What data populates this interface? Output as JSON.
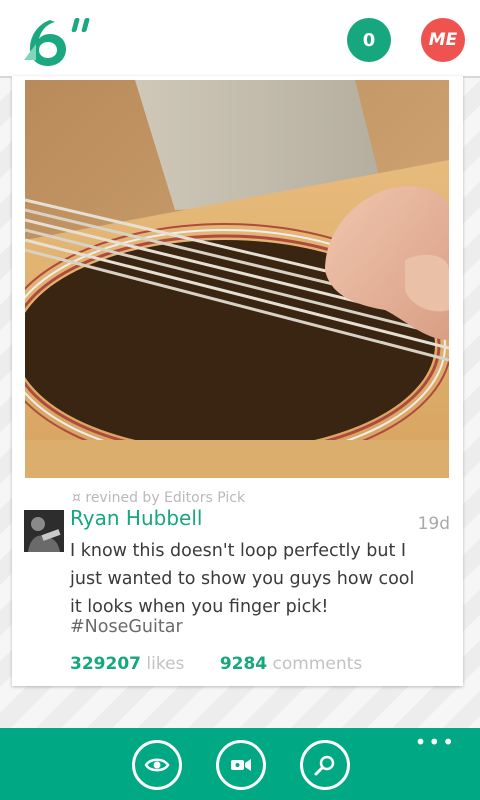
{
  "header": {
    "notifications_count": "0",
    "me_label": "ME"
  },
  "post": {
    "revine_text": "revined by Editors Pick",
    "author": "Ryan Hubbell",
    "age": "19d",
    "description": "I know this doesn't loop perfectly but I just wanted to show you guys how cool it looks when you finger pick!",
    "hashtag": "#NoseGuitar",
    "likes_count": "329207",
    "likes_label": "likes",
    "comments_count": "9284",
    "comments_label": "comments"
  },
  "appbar": {
    "more_label": "•••"
  },
  "colors": {
    "accent": "#00a884",
    "me_badge": "#ef5350"
  },
  "icons": [
    "six-inch-logo",
    "revine-icon",
    "eye-icon",
    "video-camera-icon",
    "search-icon"
  ]
}
